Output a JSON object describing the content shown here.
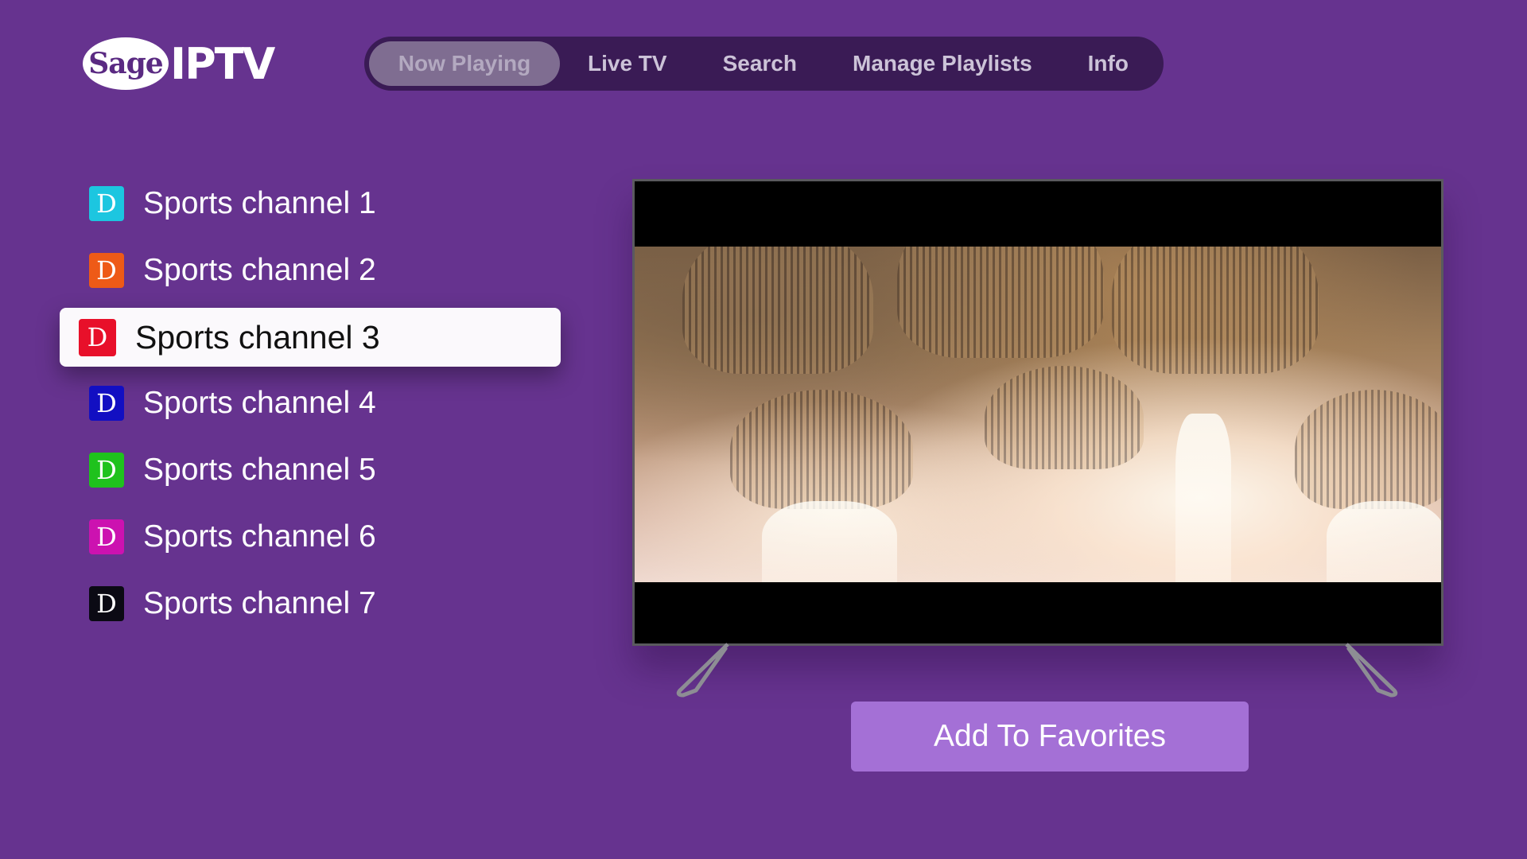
{
  "app": {
    "logo_oval_text": "Sage",
    "logo_text": "IPTV"
  },
  "nav": {
    "tabs": [
      {
        "label": "Now Playing",
        "active": true
      },
      {
        "label": "Live TV",
        "active": false
      },
      {
        "label": "Search",
        "active": false
      },
      {
        "label": "Manage Playlists",
        "active": false
      },
      {
        "label": "Info",
        "active": false
      }
    ]
  },
  "channels": {
    "selected_index": 2,
    "items": [
      {
        "badge": "D",
        "name": "Sports channel 1",
        "color": "#1cc6e0"
      },
      {
        "badge": "D",
        "name": "Sports channel 2",
        "color": "#ee5a17"
      },
      {
        "badge": "D",
        "name": "Sports channel 3",
        "color": "#e8102a"
      },
      {
        "badge": "D",
        "name": "Sports channel 4",
        "color": "#120fc2"
      },
      {
        "badge": "D",
        "name": "Sports channel 5",
        "color": "#1fc21d"
      },
      {
        "badge": "D",
        "name": "Sports channel 6",
        "color": "#cc12b0"
      },
      {
        "badge": "D",
        "name": "Sports channel 7",
        "color": "#0b0a14"
      }
    ]
  },
  "player": {
    "favorites_label": "Add To Favorites"
  },
  "colors": {
    "background": "#66338f",
    "nav_bg": "#3a1b55",
    "button": "#a470d6"
  }
}
